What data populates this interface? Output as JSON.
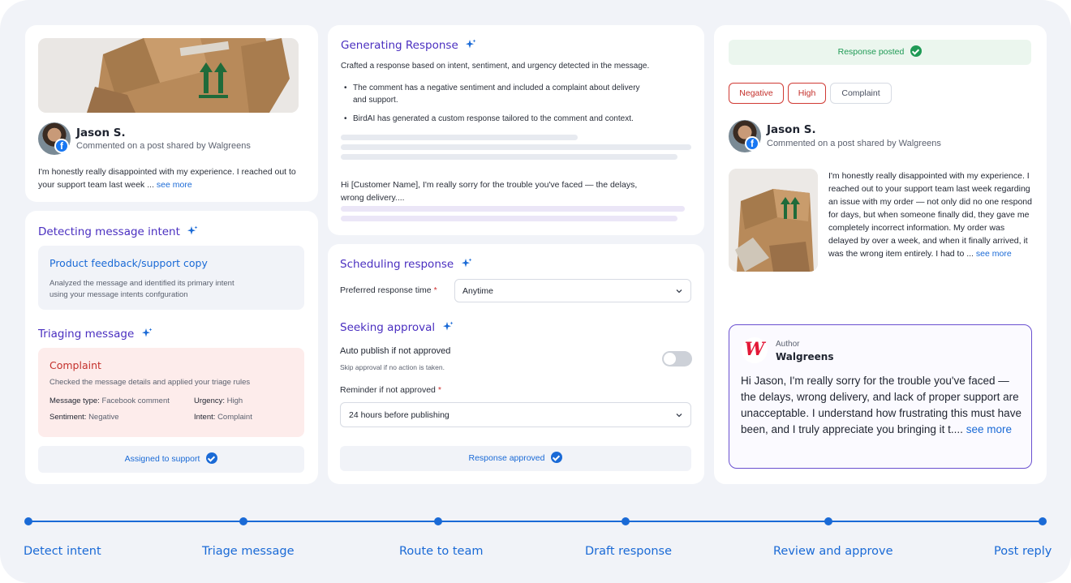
{
  "comment_card": {
    "user_name": "Jason S.",
    "user_meta": "Commented on a post shared by Walgreens",
    "text": "I'm honestly really disappointed with my experience. I reached out to your support team last week ...",
    "see_more": "see more"
  },
  "intent": {
    "title": "Detecting message intent",
    "result_title": "Product feedback/support copy",
    "result_desc_1": "Analyzed the message and identified its primary intent",
    "result_desc_2": "using your message intents confguration"
  },
  "triage": {
    "title": "Triaging message",
    "result_title": "Complaint",
    "result_desc": "Checked the message details and applied your triage rules",
    "message_type_label": "Message type:",
    "message_type_value": "Facebook comment",
    "urgency_label": "Urgency:",
    "urgency_value": "High",
    "sentiment_label": "Sentiment:",
    "sentiment_value": "Negative",
    "intent_label": "Intent:",
    "intent_value": "Complaint",
    "assigned_label": "Assigned to support"
  },
  "generating": {
    "title": "Generating Response",
    "intro": "Crafted a response based on intent, sentiment, and urgency detected in the message.",
    "bullet_1a": "The comment has a negative sentiment and included a complaint about delivery",
    "bullet_1b": "and support.",
    "bullet_2": "BirdAI has generated a custom response tailored to the comment and context.",
    "draft_1": "Hi [Customer Name], I'm really sorry for the trouble you've faced — the delays,",
    "draft_2": "wrong delivery...."
  },
  "scheduling": {
    "title": "Scheduling response",
    "pref_label": "Preferred response time",
    "required_mark": "*",
    "pref_value": "Anytime",
    "approval_title": "Seeking approval",
    "auto_publish_label": "Auto publish if not approved",
    "auto_publish_hint": "Skip approval if no action is taken.",
    "auto_publish_on": false,
    "reminder_label": "Reminder if not approved",
    "reminder_value": "24 hours before publishing",
    "approved_label": "Response approved"
  },
  "posted": {
    "status": "Response posted",
    "tags": [
      "Negative",
      "High",
      "Complaint"
    ],
    "user_name": "Jason S.",
    "user_meta": "Commented on a post shared by Walgreens",
    "full_text": "I'm honestly really disappointed with my experience. I reached out to your support team last week regarding an issue with my order — not only did no one respond for days, but when someone finally did, they gave me completely incorrect information. My order was delayed by over a week, and when it finally arrived, it was the wrong item entirely. I had to ...",
    "see_more": "see more",
    "author_caption": "Author",
    "author_name": "Walgreens",
    "reply_text": "Hi Jason, I'm really sorry for the trouble you've faced — the delays, wrong delivery, and lack of proper support are unacceptable. I understand how frustrating this must have been, and I truly appreciate you bringing it t....",
    "reply_see_more": "see more"
  },
  "timeline": [
    "Detect intent",
    "Triage message",
    "Route to team",
    "Draft response",
    "Review and approve",
    "Post reply"
  ],
  "colors": {
    "accent_blue": "#1a6ad6",
    "purple": "#4a2fc0",
    "red": "#c4302b",
    "green": "#1f9a55"
  }
}
